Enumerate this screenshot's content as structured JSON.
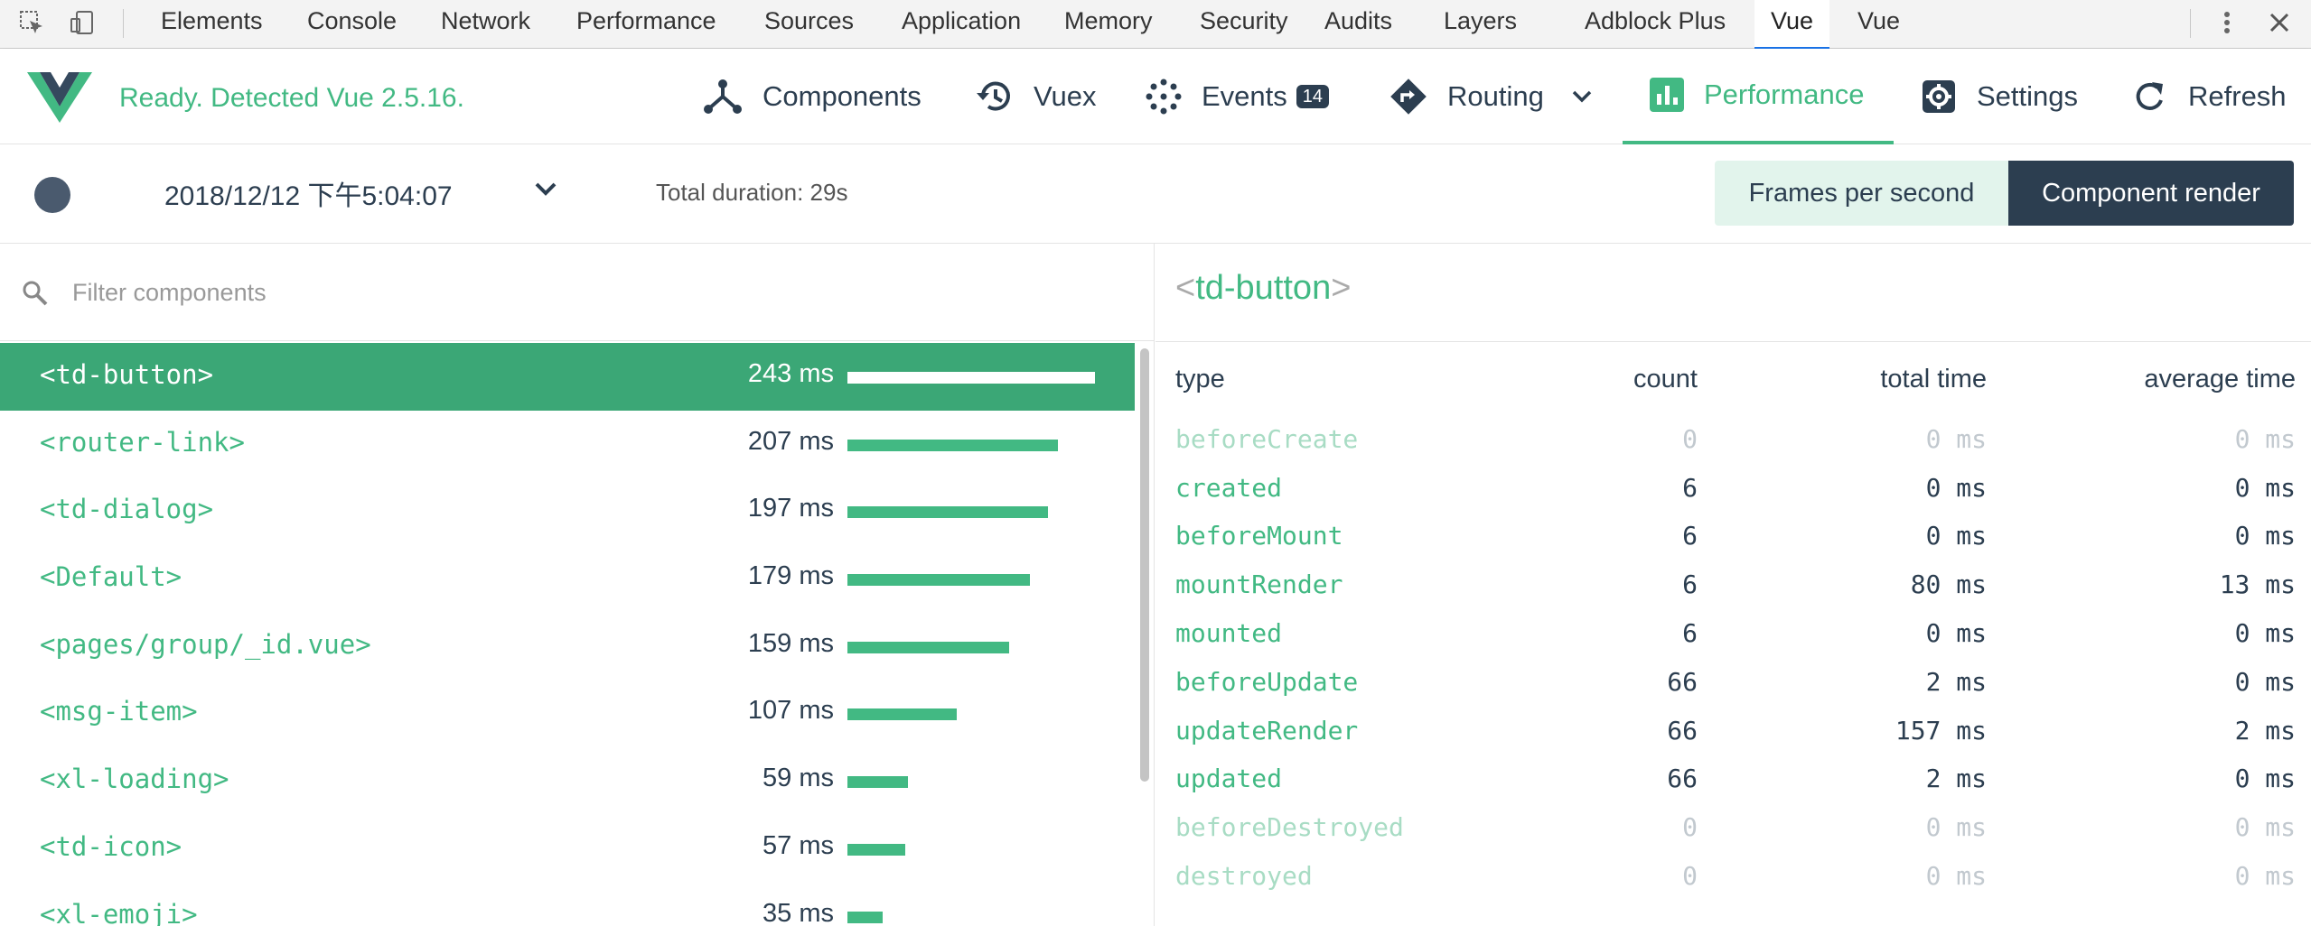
{
  "devtools": {
    "tabs": [
      "Elements",
      "Console",
      "Network",
      "Performance",
      "Sources",
      "Application",
      "Memory",
      "Security",
      "Audits",
      "Layers",
      "Adblock Plus",
      "Vue",
      "Vue"
    ],
    "active_tab_index": 11
  },
  "header": {
    "status": "Ready. Detected Vue 2.5.16.",
    "nav": {
      "components": "Components",
      "vuex": "Vuex",
      "events": "Events",
      "events_count": "14",
      "routing": "Routing",
      "performance": "Performance",
      "settings": "Settings",
      "refresh": "Refresh"
    },
    "active_nav": "performance",
    "accent_color": "#42b983",
    "dark_color": "#2c3e50"
  },
  "toolbar": {
    "recording_date": "2018/12/12 下午5:04:07",
    "total_duration": "Total duration: 29s",
    "frames_per_second": "Frames per second",
    "component_render": "Component render"
  },
  "filter": {
    "placeholder": "Filter components"
  },
  "components": [
    {
      "name": "<td-button>",
      "time": "243 ms",
      "ms": 243
    },
    {
      "name": "<router-link>",
      "time": "207 ms",
      "ms": 207
    },
    {
      "name": "<td-dialog>",
      "time": "197 ms",
      "ms": 197
    },
    {
      "name": "<Default>",
      "time": "179 ms",
      "ms": 179
    },
    {
      "name": "<pages/group/_id.vue>",
      "time": "159 ms",
      "ms": 159
    },
    {
      "name": "<msg-item>",
      "time": "107 ms",
      "ms": 107
    },
    {
      "name": "<xl-loading>",
      "time": "59 ms",
      "ms": 59
    },
    {
      "name": "<td-icon>",
      "time": "57 ms",
      "ms": 57
    },
    {
      "name": "<xl-emoji>",
      "time": "35 ms",
      "ms": 35
    }
  ],
  "selected_component_index": 0,
  "detail": {
    "open_bracket": "<",
    "name": "td-button",
    "close_bracket": ">",
    "columns": {
      "type": "type",
      "count": "count",
      "total": "total time",
      "avg": "average time"
    },
    "rows": [
      {
        "type": "beforeCreate",
        "count": "0",
        "total": "0 ms",
        "avg": "0 ms",
        "muted": true
      },
      {
        "type": "created",
        "count": "6",
        "total": "0 ms",
        "avg": "0 ms",
        "muted": false
      },
      {
        "type": "beforeMount",
        "count": "6",
        "total": "0 ms",
        "avg": "0 ms",
        "muted": false
      },
      {
        "type": "mountRender",
        "count": "6",
        "total": "80 ms",
        "avg": "13 ms",
        "muted": false
      },
      {
        "type": "mounted",
        "count": "6",
        "total": "0 ms",
        "avg": "0 ms",
        "muted": false
      },
      {
        "type": "beforeUpdate",
        "count": "66",
        "total": "2 ms",
        "avg": "0 ms",
        "muted": false
      },
      {
        "type": "updateRender",
        "count": "66",
        "total": "157 ms",
        "avg": "2 ms",
        "muted": false
      },
      {
        "type": "updated",
        "count": "66",
        "total": "2 ms",
        "avg": "0 ms",
        "muted": false
      },
      {
        "type": "beforeDestroyed",
        "count": "0",
        "total": "0 ms",
        "avg": "0 ms",
        "muted": true
      },
      {
        "type": "destroyed",
        "count": "0",
        "total": "0 ms",
        "avg": "0 ms",
        "muted": true
      }
    ]
  }
}
